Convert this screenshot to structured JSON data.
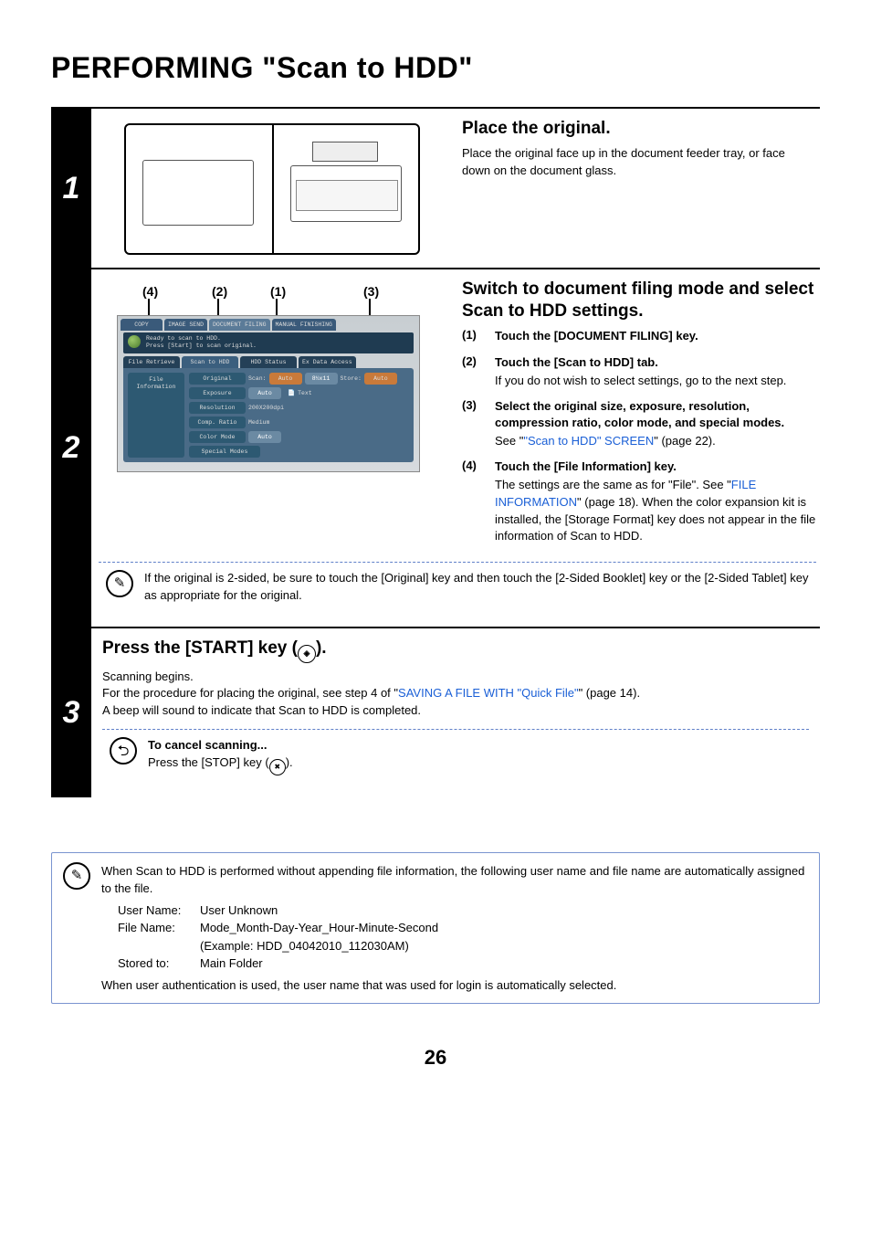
{
  "title": "PERFORMING \"Scan to HDD\"",
  "page_number": "26",
  "step1": {
    "num": "1",
    "heading": "Place the original.",
    "body": "Place the original face up in the document feeder tray, or face down on the document glass."
  },
  "step2": {
    "num": "2",
    "callouts": {
      "c1": "(1)",
      "c2": "(2)",
      "c3": "(3)",
      "c4": "(4)"
    },
    "heading": "Switch to document filing mode and select Scan to HDD settings.",
    "items": [
      {
        "num": "(1)",
        "title": "Touch the [DOCUMENT FILING] key.",
        "body": ""
      },
      {
        "num": "(2)",
        "title": "Touch the [Scan to HDD] tab.",
        "body": "If you do not wish to select settings, go to the next step."
      },
      {
        "num": "(3)",
        "title": "Select the original size, exposure, resolution, compression ratio, color mode, and special modes.",
        "body_pre": "See \"",
        "body_link": "\"Scan to HDD\" SCREEN",
        "body_post": "\" (page 22)."
      },
      {
        "num": "(4)",
        "title": "Touch the [File Information] key.",
        "body_pre": "The settings are the same as for \"File\". See \"",
        "body_link": "FILE INFORMATION",
        "body_post": "\" (page 18). When the color expansion kit is installed, the [Storage Format] key does not appear in the file information of Scan to HDD."
      }
    ],
    "note": "If the original is 2-sided, be sure to touch the [Original] key and then touch the [2-Sided Booklet] key or the [2-Sided Tablet] key as appropriate for the original.",
    "ts": {
      "tabs": [
        "COPY",
        "IMAGE SEND",
        "DOCUMENT FILING",
        "MANUAL FINISHING"
      ],
      "ready_l1": "Ready to scan to HDD.",
      "ready_l2": "Press [Start] to scan original.",
      "subtabs": [
        "File Retrieve",
        "Scan to HDD",
        "HDD Status",
        "Ex Data Access"
      ],
      "side": "File Information",
      "rows": {
        "original": {
          "key": "Original",
          "scan": "Scan:",
          "scanval": "Auto",
          "size": "8½x11",
          "store": "Store:",
          "storeval": "Auto"
        },
        "exposure": {
          "key": "Exposure",
          "val": "Auto",
          "mode": "Text"
        },
        "resolution": {
          "key": "Resolution",
          "val": "200X200dpi"
        },
        "comp": {
          "key": "Comp. Ratio",
          "val": "Medium"
        },
        "color": {
          "key": "Color Mode",
          "val": "Auto"
        },
        "special": {
          "key": "Special Modes"
        }
      }
    }
  },
  "step3": {
    "num": "3",
    "heading_pre": "Press the [START] key (",
    "heading_post": ").",
    "l1": "Scanning begins.",
    "l2_pre": "For the procedure for placing the original, see step 4 of \"",
    "l2_link": "SAVING A FILE WITH \"Quick File\"",
    "l2_post": "\" (page 14).",
    "l3": "A beep will sound to indicate that Scan to HDD is completed.",
    "cancel_h": "To cancel scanning...",
    "cancel_b_pre": "Press the [STOP] key (",
    "cancel_b_post": ")."
  },
  "boxnote": {
    "intro": "When Scan to HDD is performed without appending file information, the following user name and file name are automatically assigned to the file.",
    "rows": [
      {
        "k": "User Name:",
        "v": "User Unknown"
      },
      {
        "k": "File Name:",
        "v": "Mode_Month-Day-Year_Hour-Minute-Second"
      },
      {
        "k": "",
        "v": "(Example: HDD_04042010_112030AM)"
      },
      {
        "k": "Stored to:",
        "v": "Main Folder"
      }
    ],
    "outro": "When user authentication is used, the user name that was used for login is automatically selected."
  }
}
